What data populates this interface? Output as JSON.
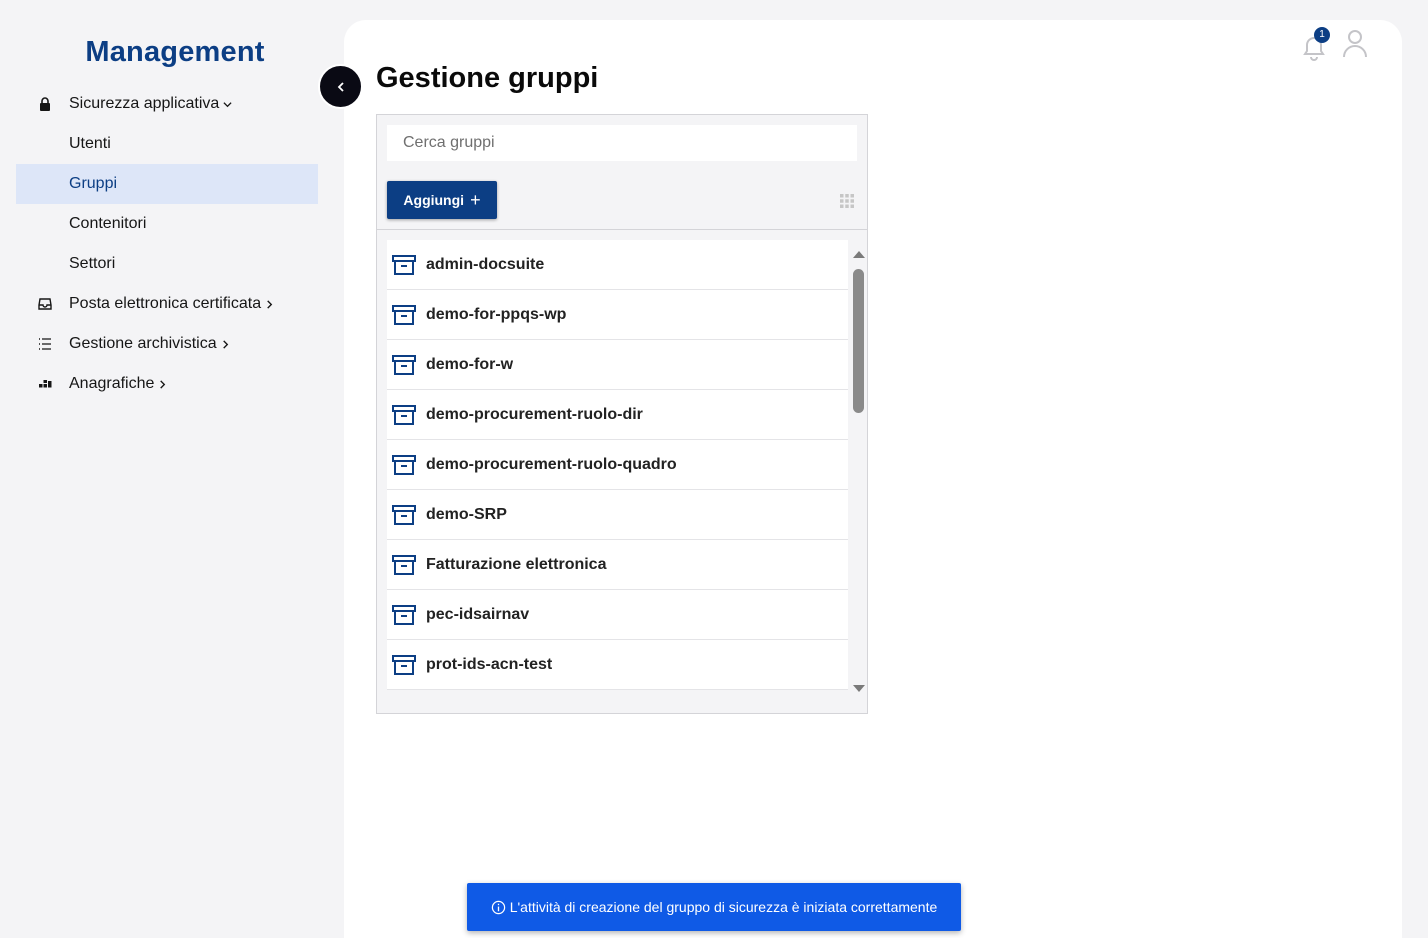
{
  "brand": {
    "title": "Management"
  },
  "nav": {
    "security": {
      "label": "Sicurezza applicativa",
      "icon": "lock-icon"
    },
    "sub": [
      {
        "label": "Utenti"
      },
      {
        "label": "Gruppi",
        "active": true
      },
      {
        "label": "Contenitori"
      },
      {
        "label": "Settori"
      }
    ],
    "pec": {
      "label": "Posta elettronica certificata",
      "icon": "inbox-icon"
    },
    "archive": {
      "label": "Gestione archivistica",
      "icon": "list-icon"
    },
    "registry": {
      "label": "Anagrafiche",
      "icon": "groups-icon"
    }
  },
  "header": {
    "notification_count": "1"
  },
  "page": {
    "title": "Gestione gruppi"
  },
  "search": {
    "placeholder": "Cerca gruppi",
    "value": ""
  },
  "toolbar": {
    "add_label": "Aggiungi",
    "add_symbol": "+"
  },
  "groups": [
    "admin-docsuite",
    "demo-for-ppqs-wp",
    "demo-for-w",
    "demo-procurement-ruolo-dir",
    "demo-procurement-ruolo-quadro",
    "demo-SRP",
    "Fatturazione elettronica",
    "pec-idsairnav",
    "prot-ids-acn-test"
  ],
  "toast": {
    "message": "L'attività di creazione del gruppo di sicurezza è iniziata correttamente"
  },
  "colors": {
    "brand": "#0c3e84",
    "active_bg": "#dde6f8",
    "toast_bg": "#0f5ae6"
  }
}
